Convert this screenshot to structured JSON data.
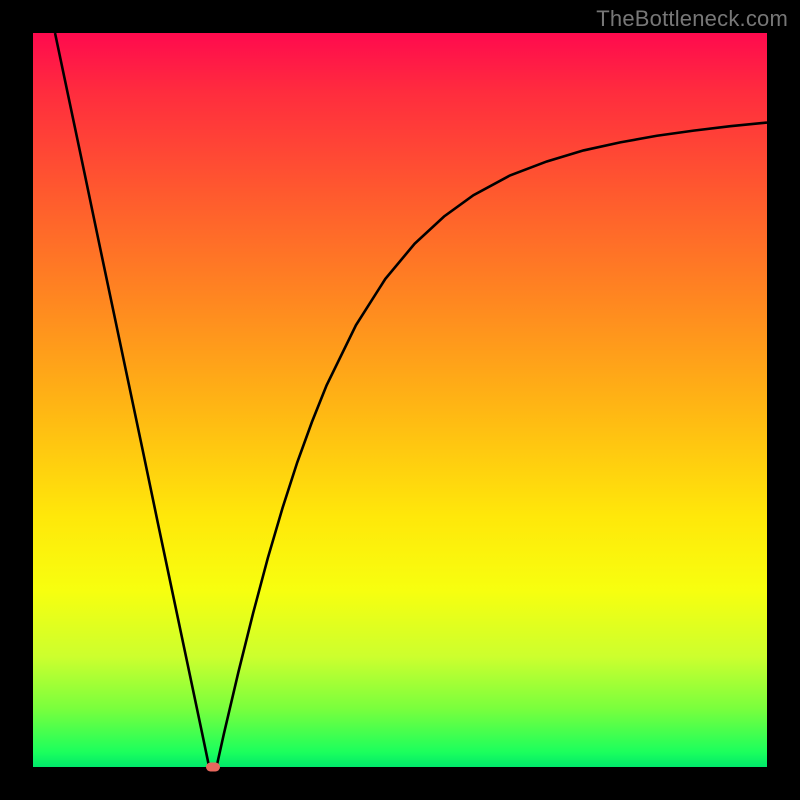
{
  "watermark": "TheBottleneck.com",
  "colors": {
    "frame": "#000000",
    "gradient_top": "#ff0a4e",
    "gradient_bottom": "#00e86a",
    "curve": "#000000",
    "marker": "#e8685e"
  },
  "chart_data": {
    "type": "line",
    "title": "",
    "xlabel": "",
    "ylabel": "",
    "xlim": [
      0,
      100
    ],
    "ylim": [
      0,
      100
    ],
    "x": [
      3,
      5,
      7,
      9,
      11,
      13,
      15,
      17,
      19,
      21,
      23,
      24,
      25,
      26,
      28,
      30,
      32,
      34,
      36,
      38,
      40,
      44,
      48,
      52,
      56,
      60,
      65,
      70,
      75,
      80,
      85,
      90,
      95,
      100
    ],
    "y": [
      100,
      90.5,
      81,
      71.4,
      61.9,
      52.4,
      42.9,
      33.3,
      23.8,
      14.3,
      4.8,
      0,
      0,
      4.5,
      13,
      21,
      28.5,
      35.3,
      41.5,
      47,
      52,
      60.2,
      66.5,
      71.3,
      75,
      77.9,
      80.6,
      82.5,
      84,
      85.1,
      86,
      86.7,
      87.3,
      87.8
    ],
    "marker": {
      "x": 24.5,
      "y": 0
    },
    "notes": "Cusp-shaped curve: linear descent from top-left to a minimum near x≈24, then concave-increasing recovery toward upper-right. Values are read in percent-of-plot coordinates (0,0 bottom-left; 100,100 top-right)."
  }
}
